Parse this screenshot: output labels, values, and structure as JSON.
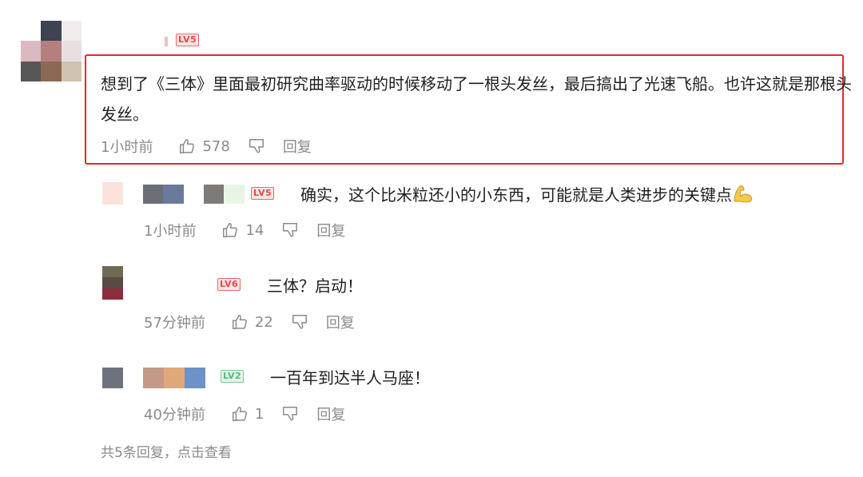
{
  "main_comment": {
    "level": "LV5",
    "text": "想到了《三体》里面最初研究曲率驱动的时候移动了一根头发丝，最后搞出了光速飞船。也许这就是那根头发丝。",
    "time": "1小时前",
    "likes": "578",
    "reply_label": "回复"
  },
  "replies": [
    {
      "level": "LV5",
      "text": "确实，这个比米粒还小的小东西，可能就是人类进步的关键点",
      "emoji": "flexed-biceps",
      "time": "1小时前",
      "likes": "14",
      "reply_label": "回复"
    },
    {
      "level": "LV6",
      "text": "三体？启动！",
      "time": "57分钟前",
      "likes": "22",
      "reply_label": "回复"
    },
    {
      "level": "LV2",
      "text": "一百年到达半人马座！",
      "time": "40分钟前",
      "likes": "1",
      "reply_label": "回复"
    }
  ],
  "footer": {
    "view_all": "共5条回复，点击查看"
  },
  "colors": {
    "highlight_border": "#e02a2a",
    "level_red": "#e24a48",
    "level_green": "#57b77a",
    "meta_gray": "#8a8a8a"
  }
}
